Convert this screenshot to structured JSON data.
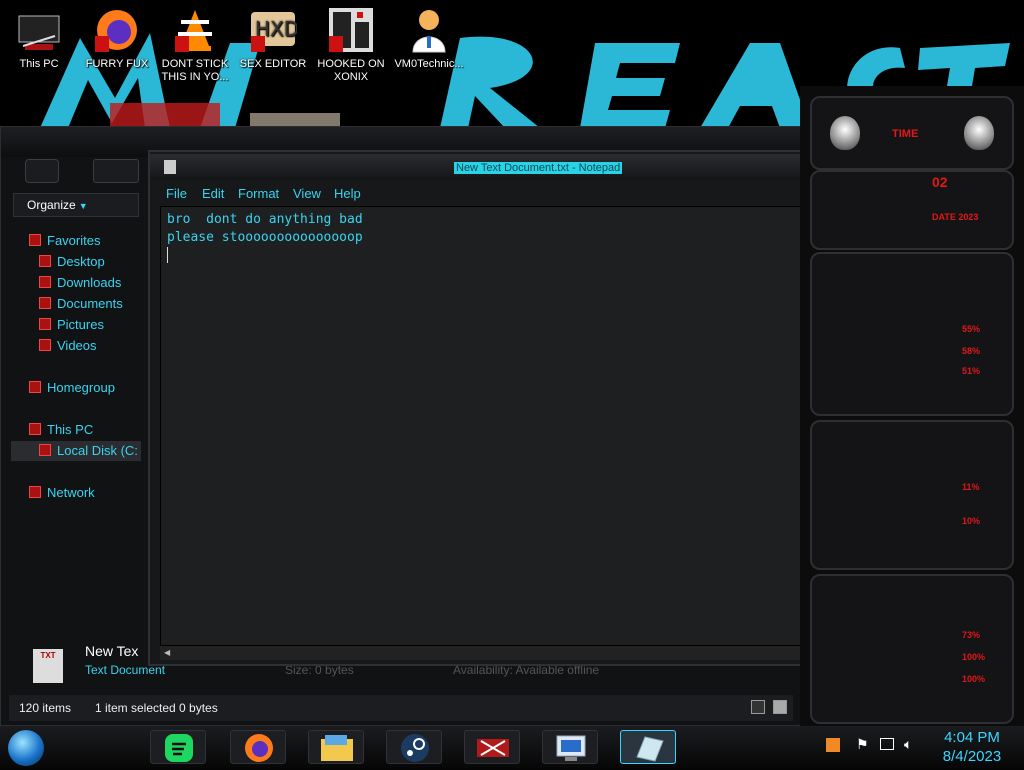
{
  "desktop": {
    "icons": [
      {
        "label": "This PC"
      },
      {
        "label": "FURRY FUX"
      },
      {
        "label": "DONT STICK THIS IN YO..."
      },
      {
        "label": "SEX EDITOR"
      },
      {
        "label": "HOOKED ON XONIX"
      },
      {
        "label": "VM0Technic..."
      }
    ]
  },
  "explorer": {
    "organize_label": "Organize",
    "tree": {
      "favorites": "Favorites",
      "desktop": "Desktop",
      "downloads": "Downloads",
      "documents": "Documents",
      "pictures": "Pictures",
      "videos": "Videos",
      "homegroup": "Homegroup",
      "this_pc": "This PC",
      "local_disk": "Local Disk (C:",
      "network": "Network"
    },
    "details": {
      "thumb_label": "TXT",
      "name": "New Tex",
      "type": "Text Document",
      "size": "Size:   0 bytes",
      "availability": "Availability:   Available offline"
    },
    "status": {
      "item_count": "120 items",
      "selection": "1 item selected  0 bytes"
    }
  },
  "notepad": {
    "title": "New Text Document.txt - Notepad",
    "menu": [
      "File",
      "Edit",
      "Format",
      "View",
      "Help"
    ],
    "lines": [
      "bro  dont do anything bad",
      "please stooooooooooooooop"
    ]
  },
  "gadget": {
    "header": "TIME",
    "readouts": [
      "02",
      "DATE 2023",
      "55%",
      "58%",
      "51%",
      "11%",
      "10%",
      "73%",
      "100%",
      "100%"
    ]
  },
  "taskbar": {
    "clock_time": "4:04 PM",
    "clock_date": "8/4/2023",
    "pinned": [
      "spotify-icon",
      "firefox-icon",
      "file-explorer-icon",
      "steam-icon",
      "media-icon",
      "remote-desktop-icon",
      "notepad-icon"
    ]
  }
}
